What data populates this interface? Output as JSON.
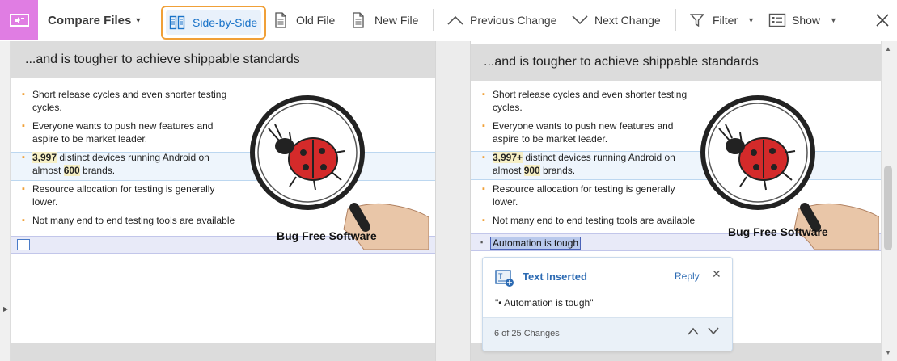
{
  "toolbar": {
    "title": "Compare Files",
    "side_by_side": "Side-by-Side",
    "old_file": "Old File",
    "new_file": "New File",
    "previous_change": "Previous Change",
    "next_change": "Next Change",
    "filter": "Filter",
    "show": "Show"
  },
  "slide": {
    "heading": "...and is tougher to achieve shippable standards",
    "caption": "Bug Free Software"
  },
  "old": {
    "bullets": [
      {
        "pre": "",
        "b1": "",
        "mid": "Short release cycles and even shorter testing cycles.",
        "b2": "",
        "post": ""
      },
      {
        "pre": "",
        "b1": "",
        "mid": "Everyone wants to push new features and aspire to be market leader.",
        "b2": "",
        "post": ""
      },
      {
        "pre": "",
        "b1": "3,997",
        "mid": " distinct devices running Android on almost ",
        "b2": "600",
        "post": " brands."
      },
      {
        "pre": "",
        "b1": "",
        "mid": "Resource allocation for testing is generally lower.",
        "b2": "",
        "post": ""
      },
      {
        "pre": "",
        "b1": "",
        "mid": "Not many end to end testing tools are available",
        "b2": "",
        "post": ""
      }
    ]
  },
  "new": {
    "bullets": [
      {
        "pre": "",
        "b1": "",
        "mid": "Short release cycles and even shorter testing cycles.",
        "b2": "",
        "post": ""
      },
      {
        "pre": "",
        "b1": "",
        "mid": "Everyone wants to push new features and aspire to be market leader.",
        "b2": "",
        "post": ""
      },
      {
        "pre": "",
        "b1": "3,997+",
        "mid": " distinct devices running Android on almost ",
        "b2": "900",
        "post": " brands."
      },
      {
        "pre": "",
        "b1": "",
        "mid": "Resource allocation for testing is generally lower.",
        "b2": "",
        "post": ""
      },
      {
        "pre": "",
        "b1": "",
        "mid": "Not many end to end testing tools are available",
        "b2": "",
        "post": ""
      }
    ],
    "inserted_text": "Automation is tough"
  },
  "popup": {
    "title": "Text Inserted",
    "reply": "Reply",
    "body": "\"• Automation is tough\"",
    "count": "6 of 25 Changes"
  },
  "colors": {
    "accent": "#1a73c8",
    "highlight_border": "#f0a038",
    "app_icon": "#e07de3",
    "bullet": "#f0a038"
  },
  "icons": {
    "app": "compare-app-icon",
    "side_by_side": "side-by-side-icon",
    "old_file": "document-icon",
    "new_file": "document-icon",
    "previous": "chevron-up-icon",
    "next": "chevron-down-icon",
    "filter": "filter-icon",
    "show": "list-icon",
    "close": "close-icon"
  }
}
